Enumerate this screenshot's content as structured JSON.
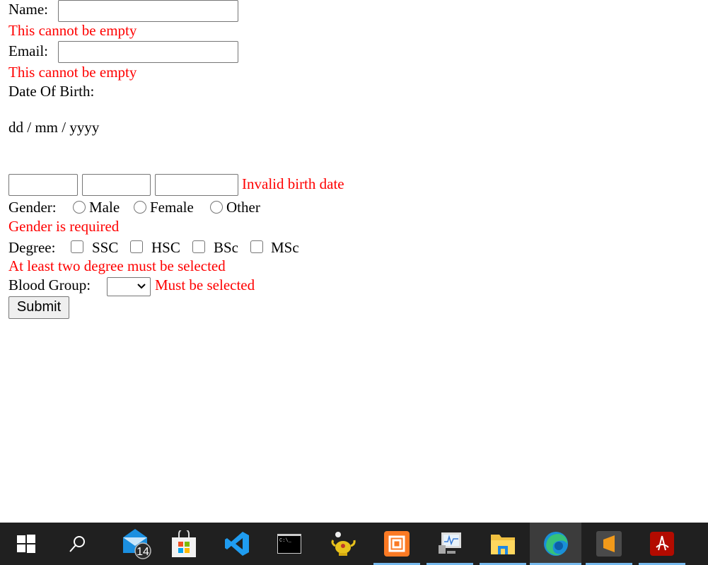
{
  "form": {
    "name_label": "Name:",
    "name_value": "",
    "name_error": "This cannot be empty",
    "email_label": "Email:",
    "email_value": "",
    "email_error": "This cannot be empty",
    "dob_label": "Date Of Birth:",
    "dob_format": "dd / mm / yyyy",
    "dob_day": "",
    "dob_month": "",
    "dob_year": "",
    "dob_error": "Invalid birth date",
    "gender_label": "Gender:",
    "gender_options": [
      "Male",
      "Female",
      "Other"
    ],
    "gender_error": "Gender is required",
    "degree_label": "Degree:",
    "degree_options": [
      "SSC",
      "HSC",
      "BSc",
      "MSc"
    ],
    "degree_error": "At least two degree must be selected",
    "blood_label": "Blood Group:",
    "blood_value": "",
    "blood_error": "Must be selected",
    "submit_label": "Submit"
  },
  "colors": {
    "error": "#ff0000",
    "taskbar": "#202020",
    "running_indicator": "#76b9ed"
  },
  "taskbar": {
    "items": [
      {
        "icon": "windows-start-icon"
      },
      {
        "icon": "search-icon"
      },
      {
        "icon": "mail-icon",
        "badge": "14"
      },
      {
        "icon": "microsoft-store-icon"
      },
      {
        "icon": "vscode-icon"
      },
      {
        "icon": "command-prompt-icon"
      },
      {
        "icon": "genie-lamp-icon"
      },
      {
        "icon": "xampp-icon",
        "running": true
      },
      {
        "icon": "performance-monitor-icon",
        "running": true
      },
      {
        "icon": "file-explorer-icon",
        "running": true
      },
      {
        "icon": "edge-icon",
        "running": true,
        "active": true
      },
      {
        "icon": "sublime-text-icon",
        "running": true
      },
      {
        "icon": "acrobat-icon",
        "running": true
      }
    ]
  }
}
